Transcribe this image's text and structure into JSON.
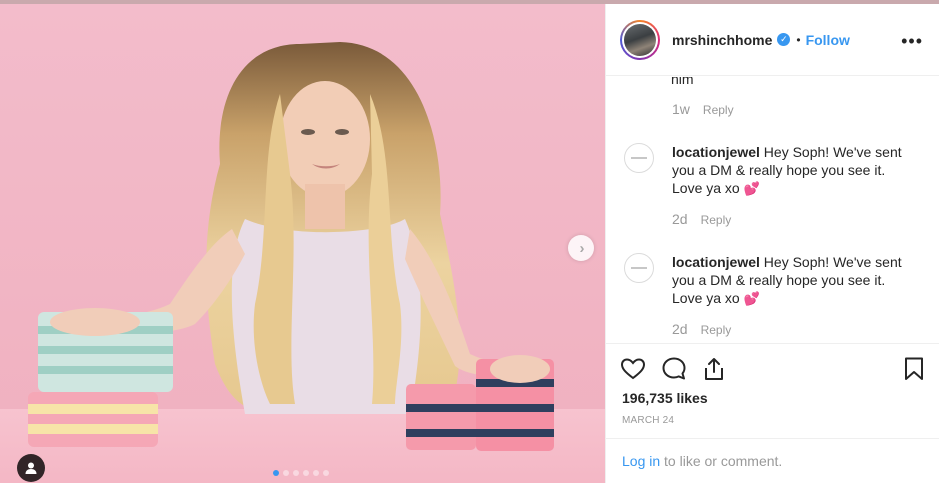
{
  "post": {
    "username": "mrshinchhome",
    "verified_mark": "✓",
    "bullet": "•",
    "follow_label": "Follow",
    "more_label": "•••",
    "carousel": {
      "slide_count": 6,
      "active_index": 0
    },
    "next_arrow": "›"
  },
  "comments": {
    "partial_text": "him",
    "partial_age": "1w",
    "items": [
      {
        "user": "locationjewel",
        "text": " Hey Soph! We've sent you a DM & really hope you see it. Love ya xo",
        "emoji": "💕",
        "age": "2d",
        "reply": "Reply"
      },
      {
        "user": "locationjewel",
        "text": " Hey Soph! We've sent you a DM & really hope you see it. Love ya xo",
        "emoji": "💕",
        "age": "2d",
        "reply": "Reply"
      }
    ],
    "reply_label": "Reply"
  },
  "stats": {
    "likes": "196,735 likes",
    "date": "MARCH 24"
  },
  "login": {
    "link": "Log in",
    "rest": " to like or comment."
  },
  "colors": {
    "accent": "#3897f0",
    "background_pink": "#f2b6c3",
    "muted_text": "#999999"
  }
}
